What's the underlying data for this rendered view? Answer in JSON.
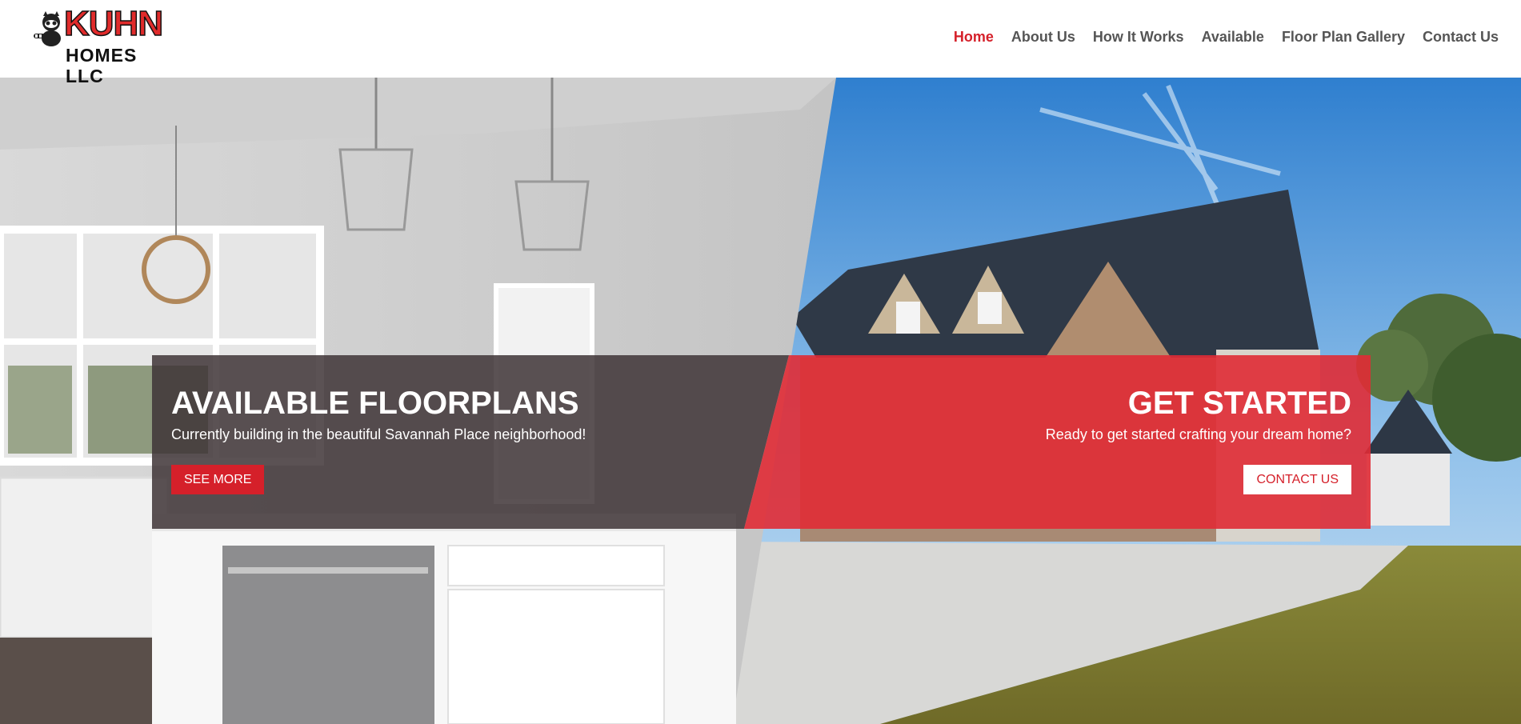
{
  "brand": {
    "logo_line1": "KUHN",
    "logo_line2": "HOMES LLC",
    "logo_mascot_icon": "raccoon-icon"
  },
  "nav": {
    "items": [
      {
        "label": "Home",
        "active": true
      },
      {
        "label": "About Us",
        "active": false
      },
      {
        "label": "How It Works",
        "active": false
      },
      {
        "label": "Available",
        "active": false
      },
      {
        "label": "Floor Plan Gallery",
        "active": false
      },
      {
        "label": "Contact Us",
        "active": false
      }
    ]
  },
  "hero": {
    "left": {
      "title": "AVAILABLE FLOORPLANS",
      "subtitle": "Currently building in the beautiful Savannah Place neighborhood!",
      "button": "SEE MORE"
    },
    "right": {
      "title": "GET STARTED",
      "subtitle": "Ready to get started crafting your dream home?",
      "button": "CONTACT US"
    }
  },
  "colors": {
    "accent": "#d5202a",
    "nav_text": "#555555",
    "left_overlay": "#4a4244",
    "right_overlay": "#e02b35"
  }
}
